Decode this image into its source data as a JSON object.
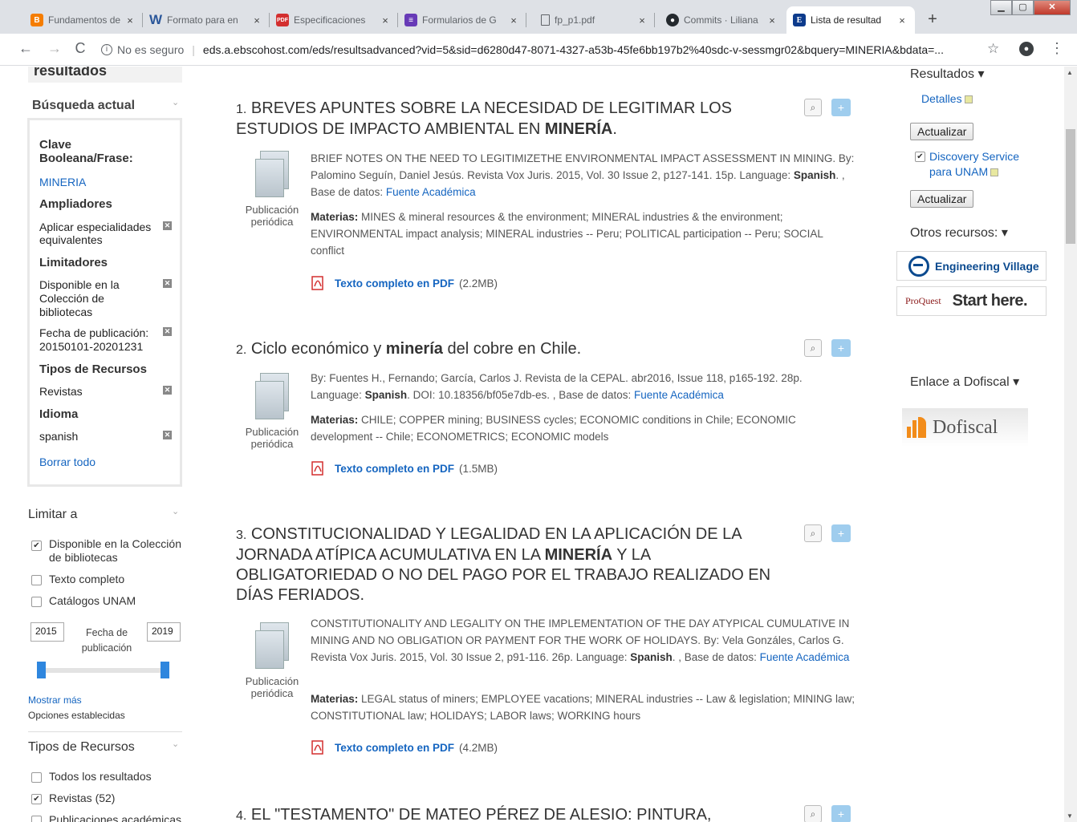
{
  "browser": {
    "tabs": [
      {
        "label": "Fundamentos de",
        "icon": "blogger-icon",
        "color": "#f57d00",
        "glyph": "B"
      },
      {
        "label": "Formato para en",
        "icon": "word-icon",
        "color": "#2b579a",
        "glyph": "W"
      },
      {
        "label": "Especificaciones",
        "icon": "pdf-icon",
        "color": "#d32f2f",
        "glyph": "PDF"
      },
      {
        "label": "Formularios de G",
        "icon": "forms-icon",
        "color": "#673ab7",
        "glyph": "≡"
      },
      {
        "label": "fp_p1.pdf",
        "icon": "file-icon",
        "color": "#ffffff",
        "glyph": ""
      },
      {
        "label": "Commits · Liliana",
        "icon": "github-icon",
        "color": "#24292e",
        "glyph": "●"
      },
      {
        "label": "Lista de resultad",
        "icon": "ebsco-icon",
        "color": "#0d3b8c",
        "glyph": "E",
        "active": true
      }
    ],
    "new_tab": "+",
    "url_security": "No es seguro",
    "url": "eds.a.ebscohost.com/eds/resultsadvanced?vid=5&sid=d6280d47-8071-4327-a53b-45fe6bb197b2%40sdc-v-sessmgr02&bquery=MINERIA&bdata=..."
  },
  "left": {
    "header": "resultados",
    "current_search_title": "Búsqueda actual",
    "boolean_label": "Clave Booleana/Frase:",
    "boolean_value": "MINERIA",
    "expanders_title": "Ampliadores",
    "expander_item": "Aplicar especialidades equivalentes",
    "limiters_title": "Limitadores",
    "limiter_1": "Disponible en la Colección de bibliotecas",
    "limiter_2": "Fecha de publicación: 20150101-20201231",
    "source_types_title": "Tipos de Recursos",
    "source_type_1": "Revistas",
    "language_title": "Idioma",
    "language_1": "spanish",
    "clear_all": "Borrar todo",
    "limit_to_title": "Limitar a",
    "limit_options": [
      {
        "label": "Disponible en la Colección de bibliotecas",
        "checked": true
      },
      {
        "label": "Texto completo",
        "checked": false
      },
      {
        "label": "Catálogos UNAM",
        "checked": false
      }
    ],
    "year_from": "2015",
    "year_to": "2019",
    "date_label": "Fecha de publicación",
    "show_more": "Mostrar más",
    "set_options": "Opciones establecidas",
    "resource_types_title": "Tipos de Recursos",
    "resource_options": [
      {
        "label": "Todos los resultados",
        "checked": false
      },
      {
        "label": "Revistas (52)",
        "checked": true
      },
      {
        "label": "Publicaciones académicas",
        "checked": false
      }
    ]
  },
  "results": [
    {
      "num": "1.",
      "title_pre": "BREVES APUNTES SOBRE LA NECESIDAD DE LEGITIMAR LOS ESTUDIOS DE IMPACTO AMBIENTAL EN ",
      "title_hit": "MINERÍA",
      "title_post": ".",
      "pub_type": "Publicación periódica",
      "desc_pre": "BRIEF NOTES ON THE NEED TO LEGITIMIZETHE ENVIRONMENTAL IMPACT ASSESSMENT IN MINING. By: Palomino Seguín, Daniel Jesús. Revista Vox Juris. 2015, Vol. 30 Issue 2, p127-141. 15p. Language: ",
      "language": "Spanish",
      "desc_post": ". , Base de datos: ",
      "database": "Fuente Académica",
      "subjects_label": "Materias:",
      "subjects": "MINES & mineral resources & the environment; MINERAL industries & the environment; ENVIRONMENTAL impact analysis; MINERAL industries -- Peru; POLITICAL participation -- Peru; SOCIAL conflict",
      "pdf_label": "Texto completo en PDF",
      "pdf_size": "(2.2MB)"
    },
    {
      "num": "2.",
      "title_pre": "Ciclo económico y ",
      "title_hit": "minería",
      "title_post": " del cobre en Chile.",
      "pub_type": "Publicación periódica",
      "desc_pre": "By: Fuentes H., Fernando; García, Carlos J. Revista de la CEPAL. abr2016, Issue 118, p165-192. 28p. Language: ",
      "language": "Spanish",
      "desc_post": ". DOI: 10.18356/bf05e7db-es. , Base de datos: ",
      "database": "Fuente Académica",
      "subjects_label": "Materias:",
      "subjects": "CHILE; COPPER mining; BUSINESS cycles; ECONOMIC conditions in Chile; ECONOMIC development -- Chile; ECONOMETRICS; ECONOMIC models",
      "pdf_label": "Texto completo en PDF",
      "pdf_size": "(1.5MB)"
    },
    {
      "num": "3.",
      "title_pre": "CONSTITUCIONALIDAD Y LEGALIDAD EN LA APLICACIÓN DE LA JORNADA ATÍPICA ACUMULATIVA EN LA ",
      "title_hit": "MINERÍA",
      "title_post": " Y LA OBLIGATORIEDAD O NO DEL PAGO POR EL TRABAJO REALIZADO EN DÍAS FERIADOS.",
      "pub_type": "Publicación periódica",
      "desc_pre": "CONSTITUTIONALITY AND LEGALITY ON THE IMPLEMENTATION OF THE DAY ATYPICAL CUMULATIVE IN MINING AND NO OBLIGATION OR PAYMENT FOR THE WORK OF HOLIDAYS. By: Vela Gonzáles, Carlos G. Revista Vox Juris. 2015, Vol. 30 Issue 2, p91-116. 26p. Language: ",
      "language": "Spanish",
      "desc_post": ". , Base de datos: ",
      "database": "Fuente Académica",
      "subjects_label": "Materias:",
      "subjects": "LEGAL status of miners; EMPLOYEE vacations; MINERAL industries -- Law & legislation; MINING law; CONSTITUTIONAL law; HOLIDAYS; LABOR laws; WORKING hours",
      "pdf_label": "Texto completo en PDF",
      "pdf_size": "(4.2MB)"
    },
    {
      "num": "4.",
      "title_pre": "EL \"TESTAMENTO\" DE MATEO PÉREZ DE ALESIO: PINTURA,",
      "title_hit": "",
      "title_post": ""
    }
  ],
  "right": {
    "results_title": "Resultados",
    "details_link": "Detalles",
    "update_button": "Actualizar",
    "discovery_label": "Discovery Service para UNAM",
    "other_resources_title": "Otros recursos:",
    "engineering_village": "Engineering Village",
    "proquest_brand": "ProQuest",
    "proquest_tagline": "Start here.",
    "dofiscal_title": "Enlace a Dofiscal",
    "dofiscal_brand": "Dofiscal"
  }
}
